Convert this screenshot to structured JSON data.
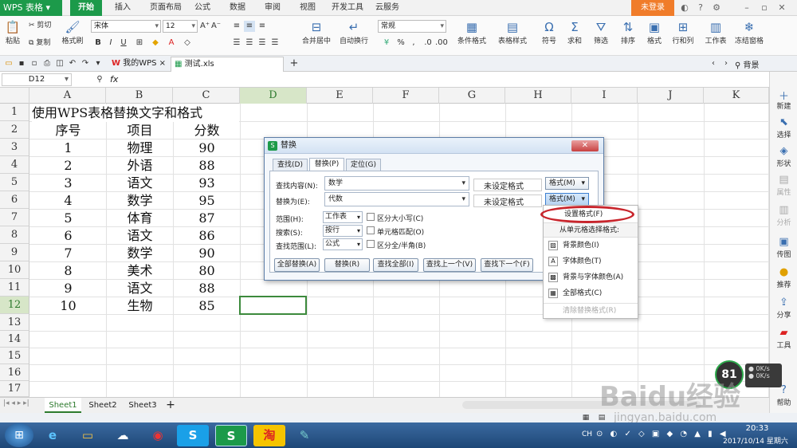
{
  "app": {
    "title": "WPS 表格"
  },
  "menu_tabs": [
    "开始",
    "插入",
    "页面布局",
    "公式",
    "数据",
    "审阅",
    "视图",
    "开发工具",
    "云服务"
  ],
  "login_label": "未登录",
  "ribbon": {
    "paste": "粘贴",
    "cut": "剪切",
    "copy": "复制",
    "format_painter": "格式刷",
    "font_name": "宋体",
    "font_size": "12",
    "merge_center": "合并居中",
    "wrap_text": "自动换行",
    "number_format": "常规",
    "conditional_format": "条件格式",
    "table_style": "表格样式",
    "symbol": "符号",
    "sum": "求和",
    "filter": "筛选",
    "sort": "排序",
    "format": "格式",
    "row_col": "行和列",
    "worksheet": "工作表",
    "freeze": "冻结窗格"
  },
  "doc_tabs": {
    "mywps": "我的WPS",
    "file": "测试.xls",
    "background": "背景"
  },
  "formula_bar": {
    "cell_ref": "D12",
    "fx": "fx"
  },
  "columns": [
    "A",
    "B",
    "C",
    "D",
    "E",
    "F",
    "G",
    "H",
    "I",
    "J",
    "K"
  ],
  "row_numbers": [
    "1",
    "2",
    "3",
    "4",
    "5",
    "6",
    "7",
    "8",
    "9",
    "10",
    "11",
    "12",
    "13",
    "14",
    "15",
    "16",
    "17"
  ],
  "sheet": {
    "title": "使用WPS表格替换文字和格式",
    "headers": [
      "序号",
      "项目",
      "分数"
    ],
    "rows": [
      [
        "1",
        "物理",
        "90"
      ],
      [
        "2",
        "外语",
        "88"
      ],
      [
        "3",
        "语文",
        "93"
      ],
      [
        "4",
        "数学",
        "95"
      ],
      [
        "5",
        "体育",
        "87"
      ],
      [
        "6",
        "语文",
        "86"
      ],
      [
        "7",
        "数学",
        "90"
      ],
      [
        "8",
        "美术",
        "80"
      ],
      [
        "9",
        "语文",
        "88"
      ],
      [
        "10",
        "生物",
        "85"
      ]
    ]
  },
  "sidebar": [
    "新建",
    "选择",
    "形状",
    "属性",
    "分析",
    "传图",
    "推荐",
    "分享",
    "工具",
    "帮助"
  ],
  "sheet_tabs": [
    "Sheet1",
    "Sheet2",
    "Sheet3"
  ],
  "dialog": {
    "title": "替换",
    "tabs": [
      "查找(D)",
      "替换(P)",
      "定位(G)"
    ],
    "find_label": "查找内容(N):",
    "find_value": "数学",
    "replace_label": "替换为(E):",
    "replace_value": "代数",
    "no_format_1": "未设定格式",
    "no_format_2": "未设定格式",
    "format_btn": "格式(M)",
    "scope_label": "范围(H):",
    "scope_value": "工作表",
    "search_label": "搜索(S):",
    "search_value": "按行",
    "lookin_label": "查找范围(L):",
    "lookin_value": "公式",
    "match_case": "区分大小写(C)",
    "match_cell": "单元格匹配(O)",
    "match_width": "区分全/半角(B)",
    "buttons": [
      "全部替换(A)",
      "替换(R)",
      "查找全部(I)",
      "查找上一个(V)",
      "查找下一个(F)"
    ]
  },
  "format_menu": {
    "items": [
      "设置格式(F)",
      "从单元格选择格式:",
      "背景颜色(I)",
      "字体颜色(T)",
      "背景与字体颜色(A)",
      "全部格式(C)",
      "清除替换格式(R)"
    ]
  },
  "speed_widget": {
    "percent": "81",
    "down": "0K/s",
    "up": "0K/s"
  },
  "watermark": {
    "logo": "Baidu经验",
    "url": "jingyan.baidu.com"
  },
  "taskbar": {
    "lang": "CH",
    "time": "20:33",
    "date": "2017/10/14 星期六"
  }
}
